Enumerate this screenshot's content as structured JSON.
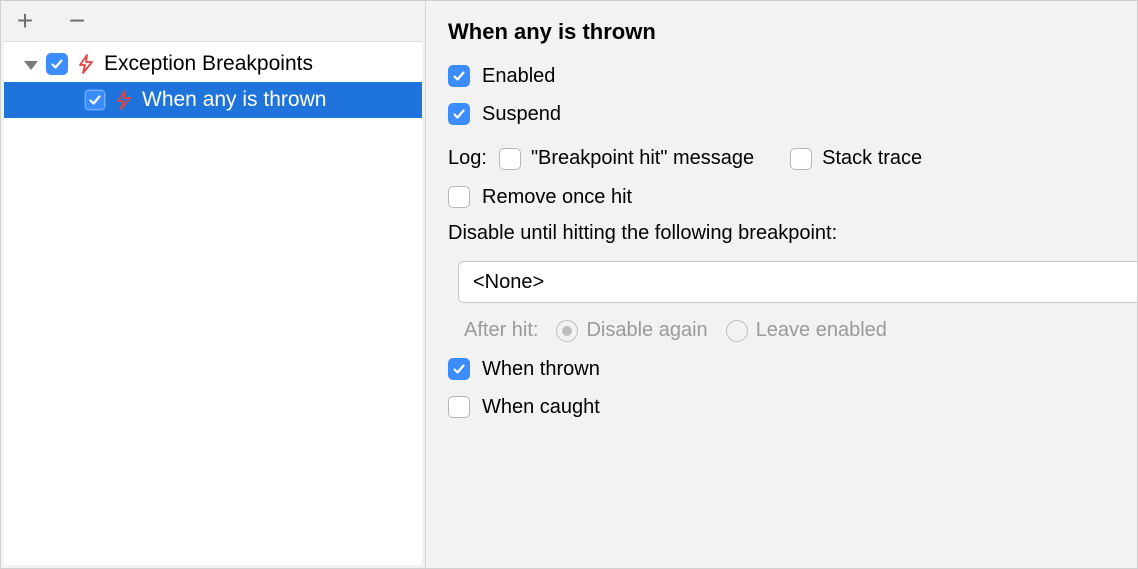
{
  "toolbar": {
    "add_label": "+",
    "remove_label": "−"
  },
  "tree": {
    "category_label": "Exception Breakpoints",
    "category_checked": true,
    "item_label": "When any is thrown",
    "item_checked": true
  },
  "details": {
    "title": "When any is thrown",
    "enabled_label": "Enabled",
    "enabled_checked": true,
    "suspend_label": "Suspend",
    "suspend_checked": true,
    "log_label": "Log:",
    "log_breakpoint_hit_label": "\"Breakpoint hit\" message",
    "log_breakpoint_hit_checked": false,
    "log_stack_trace_label": "Stack trace",
    "log_stack_trace_checked": false,
    "remove_once_hit_label": "Remove once hit",
    "remove_once_hit_checked": false,
    "disable_until_label": "Disable until hitting the following breakpoint:",
    "disable_until_value": "<None>",
    "after_hit_label": "After hit:",
    "after_hit_disable_again_label": "Disable again",
    "after_hit_leave_enabled_label": "Leave enabled",
    "after_hit_selected": "disable_again",
    "when_thrown_label": "When thrown",
    "when_thrown_checked": true,
    "when_caught_label": "When caught",
    "when_caught_checked": false
  }
}
